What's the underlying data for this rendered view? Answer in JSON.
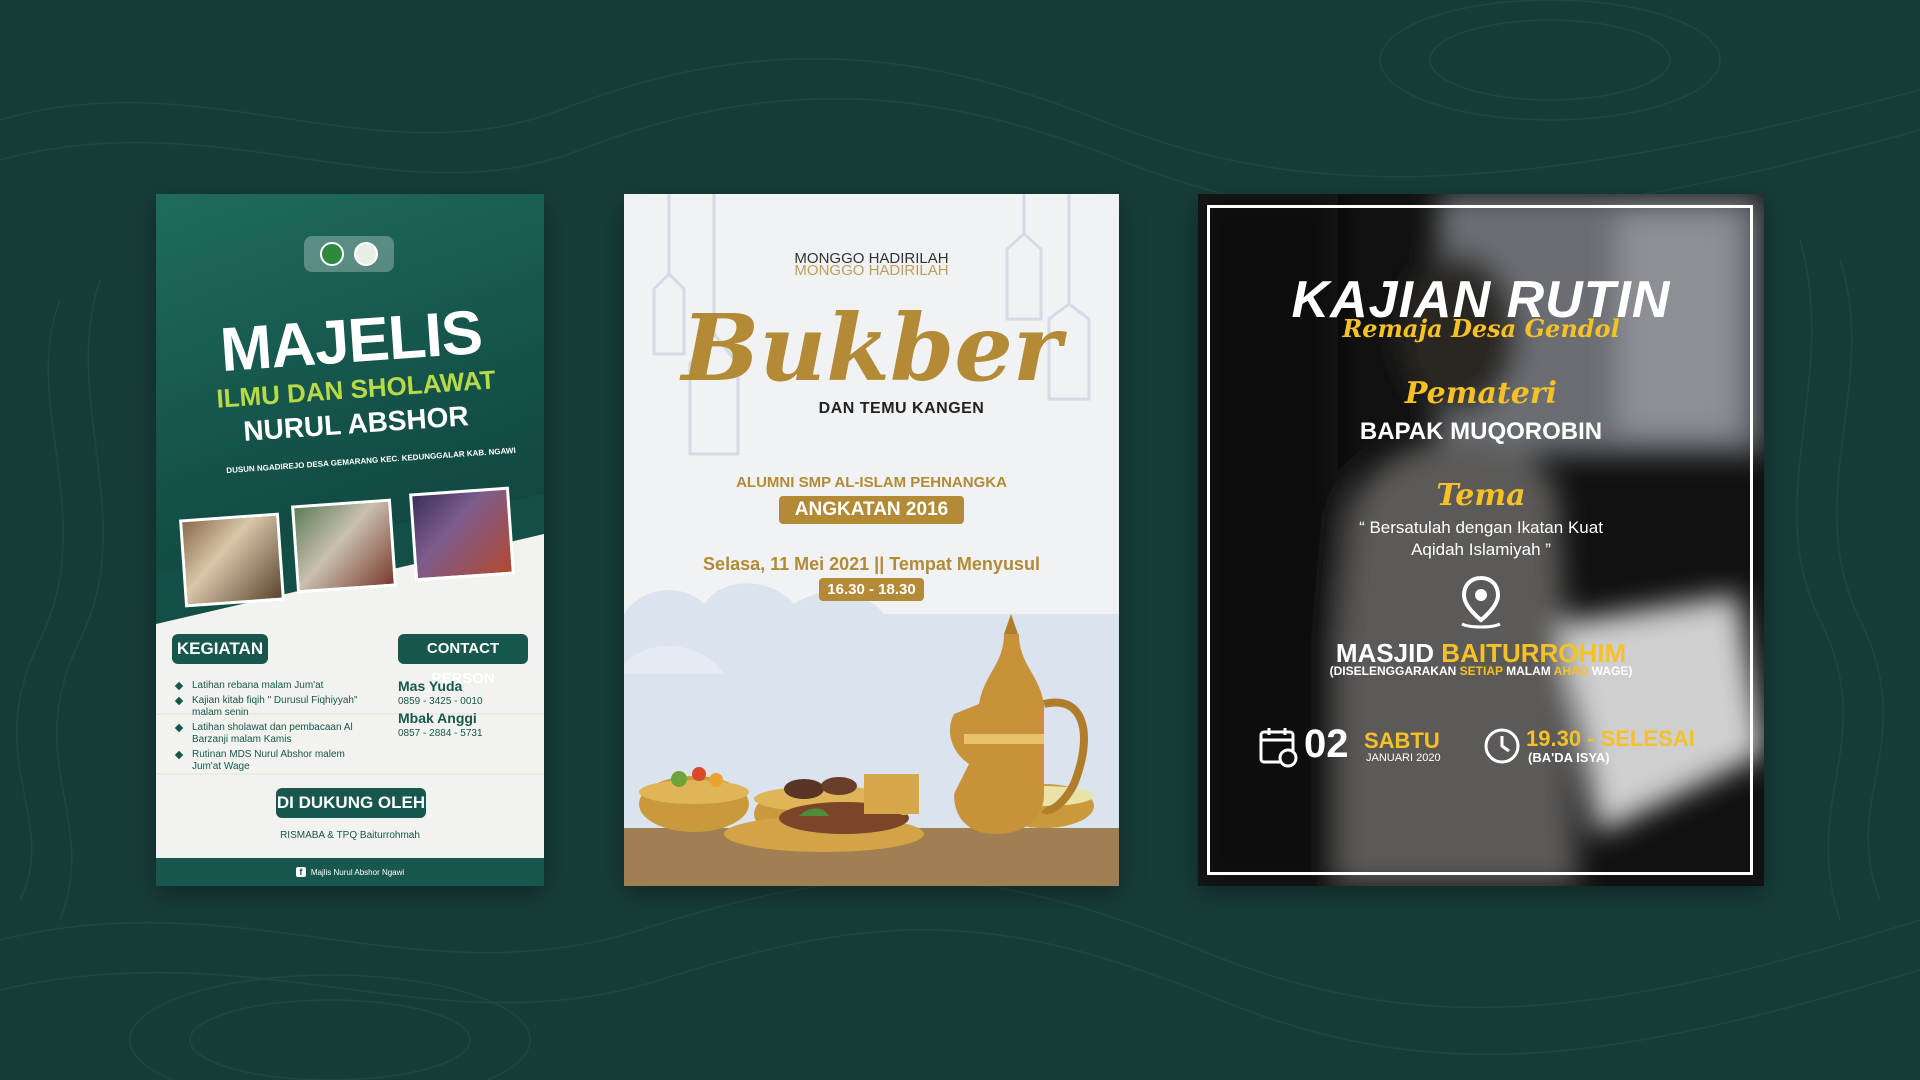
{
  "poster1": {
    "title": "MAJELIS",
    "subtitle": "ILMU DAN SHOLAWAT",
    "name": "NURUL ABSHOR",
    "address": "DUSUN NGADIREJO DESA GEMARANG KEC. KEDUNGGALAR KAB. NGAWI",
    "kegiatan_label": "KEGIATAN",
    "kegiatan_items": [
      "Latihan rebana malam Jum'at",
      "Kajian kitab fiqih \" Durusul Fiqhiyyah\" malam senin",
      "Latihan sholawat dan pembacaan Al Barzanji malam Kamis",
      "Rutinan MDS Nurul Abshor malem Jum'at Wage"
    ],
    "contact_label": "CONTACT PERSON",
    "contact1_name": "Mas Yuda",
    "contact1_phone": "0859 - 3425 - 0010",
    "contact2_name": "Mbak Anggi",
    "contact2_phone": "0857 - 2884 - 5731",
    "support_label": "DI DUKUNG OLEH",
    "support_text": "RISMABA & TPQ Baiturrohmah",
    "footer_icon": "f",
    "footer_text": "Majlis Nurul Abshor Ngawi"
  },
  "poster2": {
    "invite": "MONGGO HADIRILAH",
    "invite_echo": "MONGGO HADIRILAH",
    "title": "Bukber",
    "subtitle": "DAN TEMU KANGEN",
    "alumni": "ALUMNI SMP AL-ISLAM PEHNANGKA",
    "angkatan": "ANGKATAN 2016",
    "date_place": "Selasa, 11 Mei 2021 || Tempat Menyusul",
    "time": "16.30 - 18.30"
  },
  "poster3": {
    "title": "KAJIAN RUTIN",
    "script_sub": "Remaja Desa Gendol",
    "pemateri_label": "Pemateri",
    "pemateri_name": "BAPAK MUQOROBIN",
    "tema_label": "Tema",
    "tema_line1": "“ Bersatulah dengan Ikatan Kuat",
    "tema_line2": "Aqidah Islamiyah ”",
    "masjid_prefix": "MASJID ",
    "masjid_name": "BAITURROHIM",
    "note_a": "(DISELENGGARAKAN ",
    "note_b": "SETIAP",
    "note_c": " MALAM ",
    "note_d": "AHAD",
    "note_e": " WAGE)",
    "day_num": "02",
    "day_name": "SABTU",
    "month_year": "JANUARI 2020",
    "time": "19.30 - SELESAI",
    "time_note": "(BA'DA ISYA)"
  },
  "colors": {
    "background": "#173d39",
    "poster1_green": "#17574d",
    "poster1_lime": "#b8d94a",
    "poster2_gold": "#b38a35",
    "poster3_yellow": "#f5c126"
  }
}
